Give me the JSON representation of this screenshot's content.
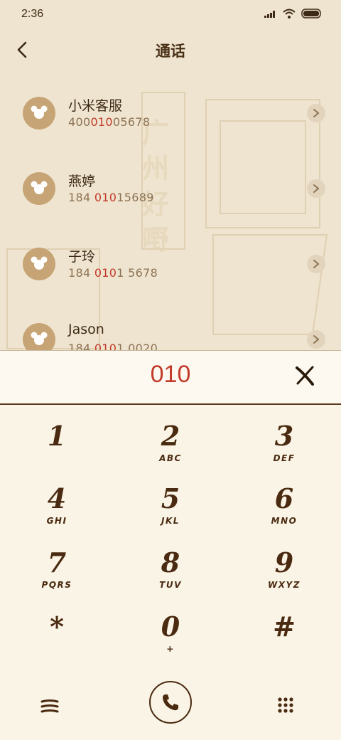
{
  "status_bar": {
    "time": "2:36",
    "icons": [
      "signal-icon",
      "wifi-icon",
      "battery-icon"
    ]
  },
  "header": {
    "title": "通话",
    "back_icon": "chevron-left-icon"
  },
  "contacts": [
    {
      "name": "小米客服",
      "number_pre": "400",
      "number_hl": "010",
      "number_post": "05678"
    },
    {
      "name": "燕婷",
      "number_pre": "184 ",
      "number_hl": "010",
      "number_post": "15689"
    },
    {
      "name": "子玲",
      "number_pre": "184 ",
      "number_hl": "010",
      "number_post": "1 5678"
    },
    {
      "name": "Jason",
      "number_pre": "184 ",
      "number_hl": "010",
      "number_post": "1 0020"
    }
  ],
  "dialpad": {
    "input": "010",
    "keys": [
      {
        "digit": "1",
        "letters": ""
      },
      {
        "digit": "2",
        "letters": "ABC"
      },
      {
        "digit": "3",
        "letters": "DEF"
      },
      {
        "digit": "4",
        "letters": "GHI"
      },
      {
        "digit": "5",
        "letters": "JKL"
      },
      {
        "digit": "6",
        "letters": "MNO"
      },
      {
        "digit": "7",
        "letters": "PQRS"
      },
      {
        "digit": "8",
        "letters": "TUV"
      },
      {
        "digit": "9",
        "letters": "WXYZ"
      },
      {
        "digit": "*",
        "letters": ""
      },
      {
        "digit": "0",
        "letters": "+"
      },
      {
        "digit": "#",
        "letters": ""
      }
    ]
  },
  "colors": {
    "accent_red": "#c23b2a",
    "ink_brown": "#4a2a10",
    "paper": "#efe4cf"
  }
}
